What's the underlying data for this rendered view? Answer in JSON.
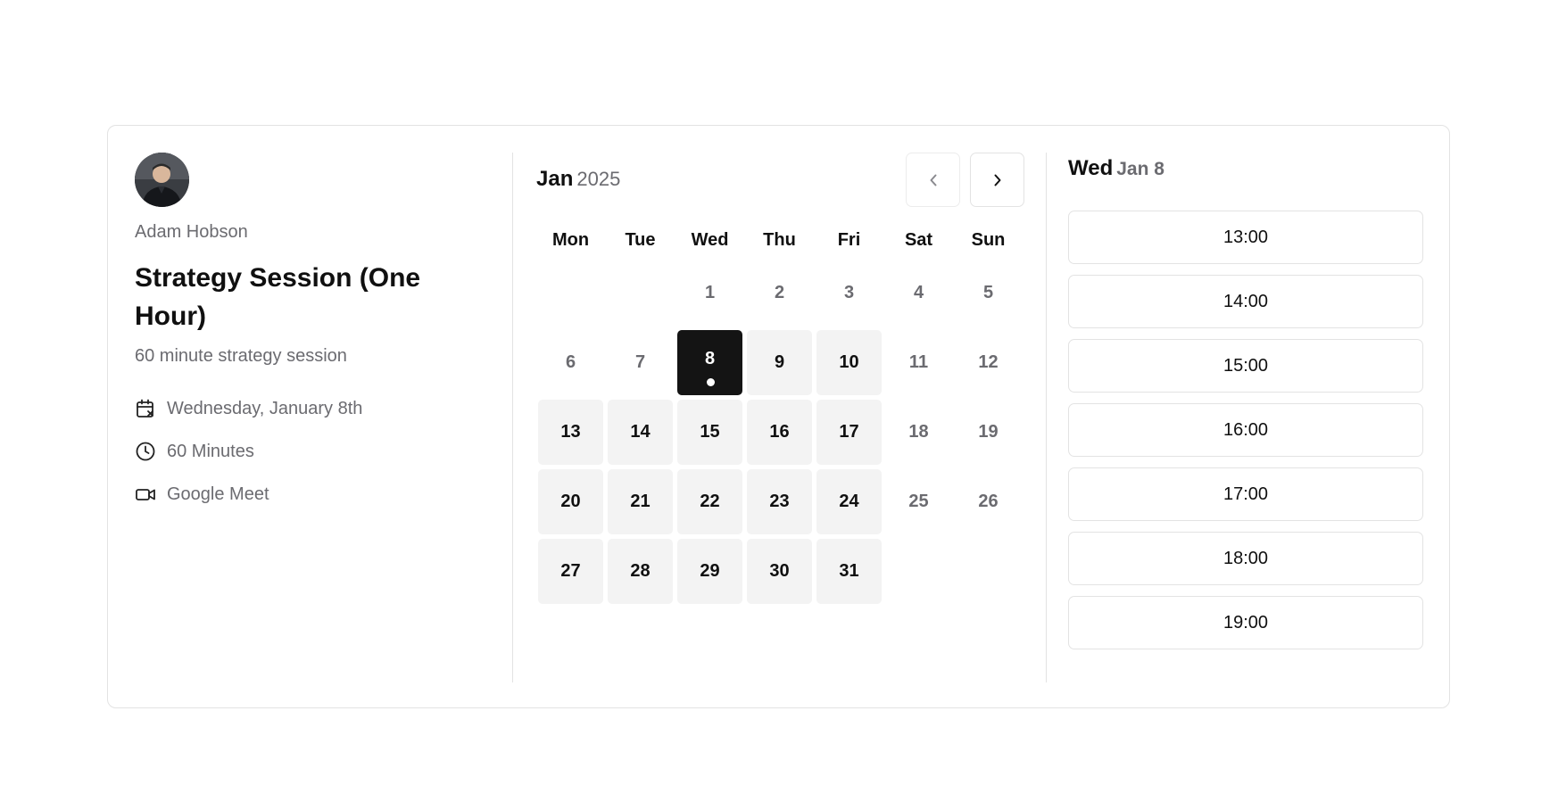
{
  "host": {
    "name": "Adam Hobson",
    "avatar_icon": "person-photo"
  },
  "event": {
    "title": "Strategy Session (One Hour)",
    "description": "60 minute strategy session",
    "details": [
      {
        "icon": "calendar-x-icon",
        "text": "Wednesday, January 8th"
      },
      {
        "icon": "clock-icon",
        "text": "60 Minutes"
      },
      {
        "icon": "video-icon",
        "text": "Google Meet"
      }
    ]
  },
  "calendar": {
    "month": "Jan",
    "year": "2025",
    "weekdays": [
      "Mon",
      "Tue",
      "Wed",
      "Thu",
      "Fri",
      "Sat",
      "Sun"
    ],
    "leading_blanks": 2,
    "days": [
      {
        "n": "1",
        "state": "unavailable"
      },
      {
        "n": "2",
        "state": "unavailable"
      },
      {
        "n": "3",
        "state": "unavailable"
      },
      {
        "n": "4",
        "state": "unavailable"
      },
      {
        "n": "5",
        "state": "unavailable"
      },
      {
        "n": "6",
        "state": "unavailable"
      },
      {
        "n": "7",
        "state": "unavailable"
      },
      {
        "n": "8",
        "state": "selected"
      },
      {
        "n": "9",
        "state": "available"
      },
      {
        "n": "10",
        "state": "available"
      },
      {
        "n": "11",
        "state": "unavailable"
      },
      {
        "n": "12",
        "state": "unavailable"
      },
      {
        "n": "13",
        "state": "available"
      },
      {
        "n": "14",
        "state": "available"
      },
      {
        "n": "15",
        "state": "available"
      },
      {
        "n": "16",
        "state": "available"
      },
      {
        "n": "17",
        "state": "available"
      },
      {
        "n": "18",
        "state": "unavailable"
      },
      {
        "n": "19",
        "state": "unavailable"
      },
      {
        "n": "20",
        "state": "available"
      },
      {
        "n": "21",
        "state": "available"
      },
      {
        "n": "22",
        "state": "available"
      },
      {
        "n": "23",
        "state": "available"
      },
      {
        "n": "24",
        "state": "available"
      },
      {
        "n": "25",
        "state": "unavailable"
      },
      {
        "n": "26",
        "state": "unavailable"
      },
      {
        "n": "27",
        "state": "available"
      },
      {
        "n": "28",
        "state": "available"
      },
      {
        "n": "29",
        "state": "available"
      },
      {
        "n": "30",
        "state": "available"
      },
      {
        "n": "31",
        "state": "available"
      }
    ]
  },
  "slots": {
    "day_name": "Wed",
    "date_label": "Jan 8",
    "times": [
      "13:00",
      "14:00",
      "15:00",
      "16:00",
      "17:00",
      "18:00",
      "19:00"
    ]
  },
  "colors": {
    "selected_bg": "#141414",
    "available_bg": "#f3f3f3",
    "muted_text": "#6b6b70",
    "border": "#e3e3e3"
  }
}
